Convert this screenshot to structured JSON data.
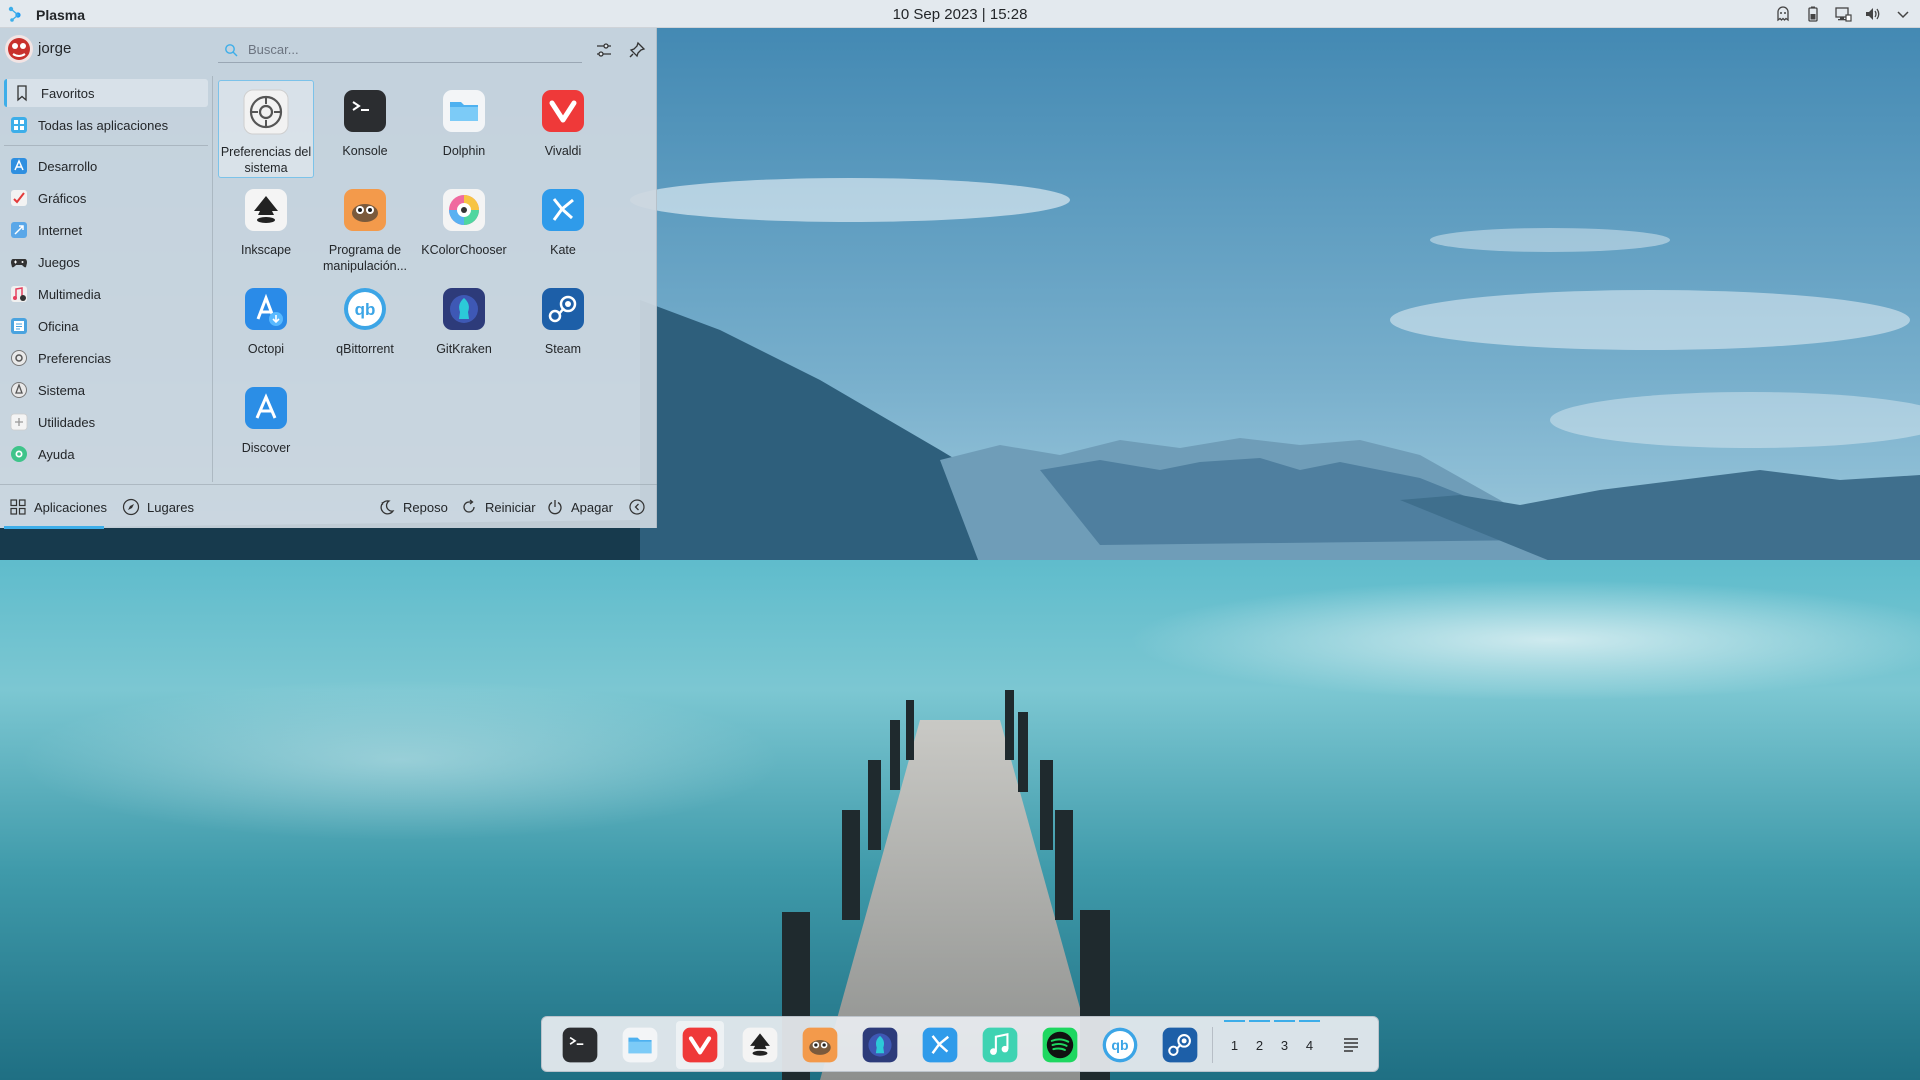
{
  "topbar": {
    "app_name": "Plasma",
    "clock": "10 Sep 2023 | 15:28",
    "tray_icons": [
      "ghost-icon",
      "battery-icon",
      "network-icon",
      "volume-icon",
      "chevron-down-icon"
    ]
  },
  "menu": {
    "username": "jorge",
    "search": {
      "placeholder": "Buscar..."
    },
    "categories": [
      {
        "label": "Favoritos",
        "icon": "bookmark-icon",
        "active": true
      },
      {
        "label": "Todas las aplicaciones",
        "icon": "grid-icon"
      },
      {
        "label": "Desarrollo",
        "icon": "development-icon"
      },
      {
        "label": "Gráficos",
        "icon": "graphics-icon"
      },
      {
        "label": "Internet",
        "icon": "internet-icon"
      },
      {
        "label": "Juegos",
        "icon": "gamepad-icon"
      },
      {
        "label": "Multimedia",
        "icon": "multimedia-icon"
      },
      {
        "label": "Oficina",
        "icon": "office-icon"
      },
      {
        "label": "Preferencias",
        "icon": "preferences-icon"
      },
      {
        "label": "Sistema",
        "icon": "system-icon"
      },
      {
        "label": "Utilidades",
        "icon": "utilities-icon"
      },
      {
        "label": "Ayuda",
        "icon": "help-icon"
      }
    ],
    "apps": [
      {
        "label": "Preferencias del sistema",
        "icon": "system-settings-icon",
        "selected": true
      },
      {
        "label": "Konsole",
        "icon": "konsole-icon"
      },
      {
        "label": "Dolphin",
        "icon": "dolphin-folder-icon"
      },
      {
        "label": "Vivaldi",
        "icon": "vivaldi-icon"
      },
      {
        "label": "Inkscape",
        "icon": "inkscape-icon"
      },
      {
        "label": "Programa de manipulación...",
        "icon": "gimp-icon"
      },
      {
        "label": "KColorChooser",
        "icon": "kcolorchooser-icon"
      },
      {
        "label": "Kate",
        "icon": "kate-icon"
      },
      {
        "label": "Octopi",
        "icon": "octopi-icon"
      },
      {
        "label": "qBittorrent",
        "icon": "qbittorrent-icon"
      },
      {
        "label": "GitKraken",
        "icon": "gitkraken-icon"
      },
      {
        "label": "Steam",
        "icon": "steam-icon"
      },
      {
        "label": "Discover",
        "icon": "discover-icon"
      }
    ],
    "footer": {
      "tabs": [
        {
          "label": "Aplicaciones",
          "icon": "apps-grid-icon",
          "active": true
        },
        {
          "label": "Lugares",
          "icon": "compass-icon"
        }
      ],
      "actions": [
        {
          "label": "Reposo",
          "icon": "sleep-icon"
        },
        {
          "label": "Reiniciar",
          "icon": "restart-icon"
        },
        {
          "label": "Apagar",
          "icon": "power-icon"
        }
      ]
    }
  },
  "dock": {
    "items": [
      {
        "name": "konsole",
        "icon": "konsole-icon"
      },
      {
        "name": "dolphin",
        "icon": "dolphin-folder-icon"
      },
      {
        "name": "vivaldi",
        "icon": "vivaldi-icon",
        "highlighted": true
      },
      {
        "name": "inkscape",
        "icon": "inkscape-icon"
      },
      {
        "name": "gimp",
        "icon": "gimp-icon"
      },
      {
        "name": "gitkraken",
        "icon": "gitkraken-icon"
      },
      {
        "name": "kate",
        "icon": "kate-icon"
      },
      {
        "name": "music",
        "icon": "music-icon"
      },
      {
        "name": "spotify",
        "icon": "spotify-icon"
      },
      {
        "name": "qbittorrent",
        "icon": "qbittorrent-icon"
      },
      {
        "name": "steam",
        "icon": "steam-icon"
      }
    ],
    "pager": [
      "1",
      "2",
      "3",
      "4"
    ]
  },
  "colors": {
    "accent": "#3daee9",
    "text": "#232629",
    "menu_bg": "#ced7e0",
    "topbar_bg": "#eceef1"
  }
}
